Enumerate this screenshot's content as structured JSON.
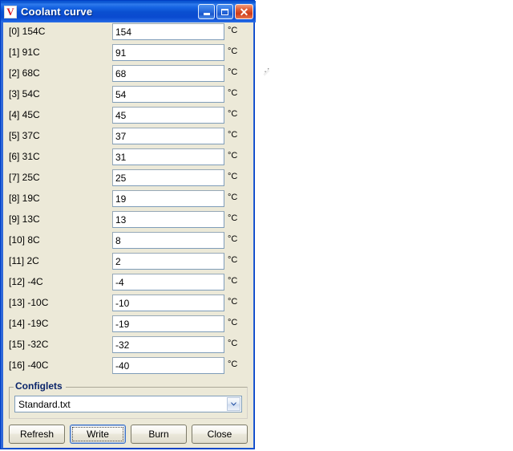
{
  "window": {
    "title": "Coolant curve",
    "icon": "app-v-icon",
    "icon_glyph": "V",
    "controls": [
      {
        "name": "minimize",
        "label": "Minimize",
        "glyph": "_"
      },
      {
        "name": "maximize",
        "label": "Maximize",
        "glyph": "□"
      },
      {
        "name": "close",
        "label": "Close",
        "glyph": "✕"
      }
    ],
    "titlebar_color": "#0a4fd0",
    "client_color": "#ece9d8"
  },
  "curve": {
    "unit": "°C",
    "rows": [
      {
        "label": "[0] 154C",
        "value": "154"
      },
      {
        "label": "[1] 91C",
        "value": "91"
      },
      {
        "label": "[2] 68C",
        "value": "68"
      },
      {
        "label": "[3] 54C",
        "value": "54"
      },
      {
        "label": "[4] 45C",
        "value": "45"
      },
      {
        "label": "[5] 37C",
        "value": "37"
      },
      {
        "label": "[6] 31C",
        "value": "31"
      },
      {
        "label": "[7] 25C",
        "value": "25"
      },
      {
        "label": "[8] 19C",
        "value": "19"
      },
      {
        "label": "[9] 13C",
        "value": "13"
      },
      {
        "label": "[10] 8C",
        "value": "8"
      },
      {
        "label": "[11] 2C",
        "value": "2"
      },
      {
        "label": "[12] -4C",
        "value": "-4"
      },
      {
        "label": "[13] -10C",
        "value": "-10"
      },
      {
        "label": "[14] -19C",
        "value": "-19"
      },
      {
        "label": "[15] -32C",
        "value": "-32"
      },
      {
        "label": "[16] -40C",
        "value": "-40"
      }
    ]
  },
  "configlets": {
    "legend": "Configlets",
    "legend_color": "#0a246a",
    "selected": "Standard.txt",
    "dropdown_icon": "chevron-down-icon"
  },
  "buttons": [
    {
      "name": "refresh",
      "label": "Refresh",
      "focused": false
    },
    {
      "name": "write",
      "label": "Write",
      "focused": true
    },
    {
      "name": "burn",
      "label": "Burn",
      "focused": false
    },
    {
      "name": "close",
      "label": "Close",
      "focused": false
    }
  ]
}
